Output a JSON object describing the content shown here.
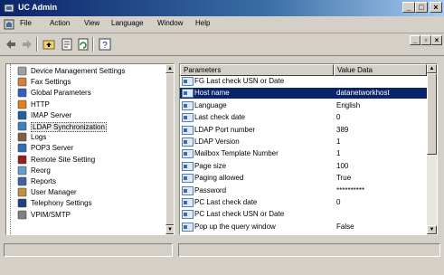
{
  "window": {
    "title": "UC Admin"
  },
  "menu": [
    "File",
    "Action",
    "View",
    "Language",
    "Window",
    "Help"
  ],
  "tree": {
    "items": [
      {
        "label": "Device Management Settings",
        "icon": "device-management-icon"
      },
      {
        "label": "Fax Settings",
        "icon": "fax-icon"
      },
      {
        "label": "Global Parameters",
        "icon": "globe-icon"
      },
      {
        "label": "HTTP",
        "icon": "http-icon"
      },
      {
        "label": "IMAP Server",
        "icon": "imap-server-icon"
      },
      {
        "label": "LDAP Synchronization",
        "icon": "ldap-sync-icon"
      },
      {
        "label": "Logs",
        "icon": "logs-icon"
      },
      {
        "label": "POP3 Server",
        "icon": "pop3-server-icon"
      },
      {
        "label": "Remote Site Setting",
        "icon": "remote-site-icon"
      },
      {
        "label": "Reorg",
        "icon": "reorg-icon"
      },
      {
        "label": "Reports",
        "icon": "reports-icon"
      },
      {
        "label": "User Manager",
        "icon": "user-manager-icon"
      },
      {
        "label": "Telephony Settings",
        "icon": "telephony-icon"
      },
      {
        "label": "VPIM/SMTP",
        "icon": "vpim-smtp-icon"
      }
    ],
    "selected_index": 5
  },
  "params": {
    "headers": {
      "name": "Parameters",
      "value": "Value Data"
    },
    "rows": [
      {
        "name": "FG Last check USN or Date",
        "value": ""
      },
      {
        "name": "Host name",
        "value": "datanetworkhost"
      },
      {
        "name": "Language",
        "value": "English"
      },
      {
        "name": "Last check date",
        "value": "0"
      },
      {
        "name": "LDAP Port number",
        "value": "389"
      },
      {
        "name": "LDAP Version",
        "value": "1"
      },
      {
        "name": "Mailbox Template Number",
        "value": "1"
      },
      {
        "name": "Page size",
        "value": "100"
      },
      {
        "name": "Paging allowed",
        "value": "True"
      },
      {
        "name": "Password",
        "value": "**********"
      },
      {
        "name": "PC Last check date",
        "value": "0"
      },
      {
        "name": "PC Last check USN or Date",
        "value": ""
      },
      {
        "name": "Pop up the query window",
        "value": "False"
      }
    ],
    "selected_index": 1
  },
  "colors": {
    "selection": "#0a246a",
    "title_start": "#0a246a",
    "title_end": "#a6caf0"
  }
}
